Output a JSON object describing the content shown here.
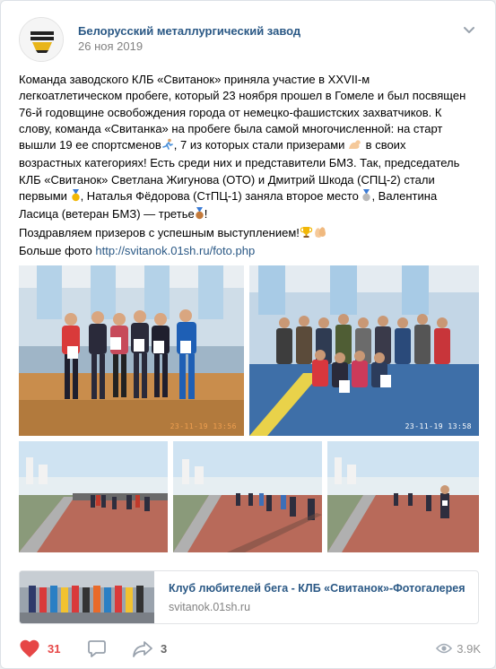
{
  "post": {
    "author": "Белорусский металлургический завод",
    "date": "26 ноя 2019",
    "text_lines": {
      "l1": "Команда заводского КЛБ «Свитанок» приняла участие в XXVII-м",
      "l2": "легкоатлетическом пробеге, который 23 ноября прошел в Гомеле и был посвящен",
      "l3": "76-й годовщине освобождения города от немецко-фашистских захватчиков. К",
      "l4": "слову, команда «Свитанка» на пробеге была самой многочисленной: на старт",
      "l5a": "вышли 19 ее спортсменов",
      "l5b": ", 7 из которых стали призерами",
      "l5c": " в своих",
      "l6": "возрастных категориях! Есть среди них и представители БМЗ. Так, председатель",
      "l7": "КЛБ «Свитанок» Светлана Жигунова (ОТО) и Дмитрий Шкода (СПЦ-2) стали",
      "l8a": "первыми",
      "l8b": ", Наталья Фёдорова (СтПЦ-1) заняла второе место",
      "l8c": ", Валентина",
      "l9a": "Ласица (ветеран БМЗ) — третье",
      "l9b": "!",
      "l10a": "Поздравляем призеров с успешным выступлением!",
      "l11a": "Больше фото ",
      "link": "http://svitanok.01sh.ru/foto.php"
    },
    "photos": [
      {
        "name": "team-photo-1",
        "stamp": "23-11-19 13:56"
      },
      {
        "name": "team-photo-2",
        "stamp": "23-11-19 13:58"
      },
      {
        "name": "race-photo-1",
        "stamp": ""
      },
      {
        "name": "race-photo-2",
        "stamp": ""
      },
      {
        "name": "race-photo-3",
        "stamp": ""
      }
    ],
    "link_card": {
      "title": "Клуб любителей бега - КЛБ «Свитанок»-Фотогалерея",
      "domain": "svitanok.01sh.ru"
    },
    "actions": {
      "likes": "31",
      "shares": "3",
      "views": "3.9K"
    },
    "icons": [
      "chevron-down-icon",
      "runner-emoji",
      "flexed-biceps-emoji",
      "gold-medal-emoji",
      "silver-medal-emoji",
      "bronze-medal-emoji",
      "trophy-emoji",
      "clapping-hands-emoji",
      "heart-icon",
      "comment-icon",
      "share-icon",
      "eye-icon"
    ],
    "colors": {
      "link": "#2a5885",
      "like": "#e64646",
      "muted": "#828282"
    }
  }
}
